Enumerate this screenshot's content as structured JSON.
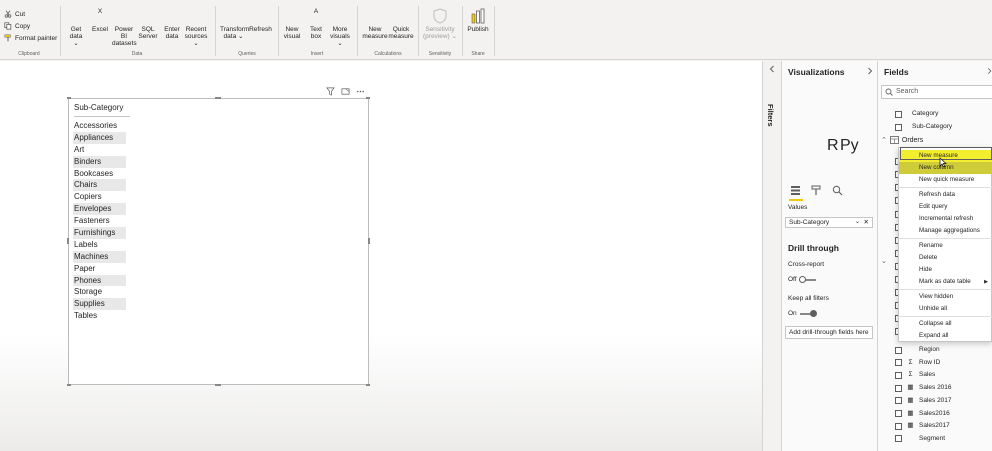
{
  "ribbon": {
    "clipboard": {
      "cut": "Cut",
      "copy": "Copy",
      "format_painter": "Format painter",
      "group": "Clipboard"
    },
    "data": {
      "group": "Data",
      "buttons": [
        {
          "label": "Get data",
          "sub": "⌄",
          "icon": "get-data-icon",
          "color": "#605e5c"
        },
        {
          "label": "Excel",
          "sub": "",
          "icon": "excel-icon",
          "color": "#217346"
        },
        {
          "label": "Power BI",
          "sub": "datasets",
          "icon": "powerbi-datasets-icon",
          "color": "#605e5c"
        },
        {
          "label": "SQL",
          "sub": "Server",
          "icon": "sql-server-icon",
          "color": "#605e5c"
        },
        {
          "label": "Enter",
          "sub": "data",
          "icon": "enter-data-icon",
          "color": "#605e5c"
        },
        {
          "label": "Recent",
          "sub": "sources ⌄",
          "icon": "recent-sources-icon",
          "color": "#605e5c"
        }
      ]
    },
    "queries": {
      "group": "Queries",
      "buttons": [
        {
          "label": "Transform",
          "sub": "data ⌄",
          "icon": "transform-data-icon"
        },
        {
          "label": "Refresh",
          "sub": "",
          "icon": "refresh-icon"
        }
      ]
    },
    "insert": {
      "group": "Insert",
      "buttons": [
        {
          "label": "New",
          "sub": "visual",
          "icon": "new-visual-icon"
        },
        {
          "label": "Text",
          "sub": "box",
          "icon": "text-box-icon"
        },
        {
          "label": "More",
          "sub": "visuals ⌄",
          "icon": "more-visuals-icon"
        }
      ]
    },
    "calculations": {
      "group": "Calculations",
      "buttons": [
        {
          "label": "New",
          "sub": "measure",
          "icon": "new-measure-icon"
        },
        {
          "label": "Quick",
          "sub": "measure",
          "icon": "quick-measure-icon"
        }
      ]
    },
    "sensitivity": {
      "group": "Sensitivity",
      "label": "Sensitivity",
      "sub": "(preview) ⌄"
    },
    "share": {
      "group": "Share",
      "label": "Publish"
    }
  },
  "slicer": {
    "title": "Sub-Category",
    "items": [
      "Accessories",
      "Appliances",
      "Art",
      "Binders",
      "Bookcases",
      "Chairs",
      "Copiers",
      "Envelopes",
      "Fasteners",
      "Furnishings",
      "Labels",
      "Machines",
      "Paper",
      "Phones",
      "Storage",
      "Supplies",
      "Tables"
    ]
  },
  "filters": {
    "label": "Filters"
  },
  "visualizations": {
    "title": "Visualizations",
    "values_label": "Values",
    "values_field": "Sub-Category",
    "drill_through": "Drill through",
    "cross_report": "Cross-report",
    "cross_report_state": "Off",
    "keep_filters": "Keep all filters",
    "keep_filters_state": "On",
    "add_fields": "Add drill-through fields here"
  },
  "fields": {
    "title": "Fields",
    "search_placeholder": "Search",
    "top_rows": [
      "Category",
      "Sub-Category"
    ],
    "table_name": "Orders",
    "bottom_rows": [
      {
        "label": "Region",
        "type": ""
      },
      {
        "label": "Row ID",
        "type": "Σ"
      },
      {
        "label": "Sales",
        "type": "Σ"
      },
      {
        "label": "Sales 2016",
        "type": "▦"
      },
      {
        "label": "Sales 2017",
        "type": "▦"
      },
      {
        "label": "Sales2016",
        "type": "▦"
      },
      {
        "label": "Sales2017",
        "type": "▦"
      },
      {
        "label": "Segment",
        "type": ""
      }
    ]
  },
  "context_menu": {
    "items": [
      "New measure",
      "New column",
      "New quick measure",
      "Refresh data",
      "Edit query",
      "Incremental refresh",
      "Manage aggregations",
      "Rename",
      "Delete",
      "Hide",
      "Mark as date table",
      "View hidden",
      "Unhide all",
      "Collapse all",
      "Expand all"
    ]
  },
  "colors": {
    "highlight": "#f4ef2e",
    "accent": "#f2c811"
  }
}
